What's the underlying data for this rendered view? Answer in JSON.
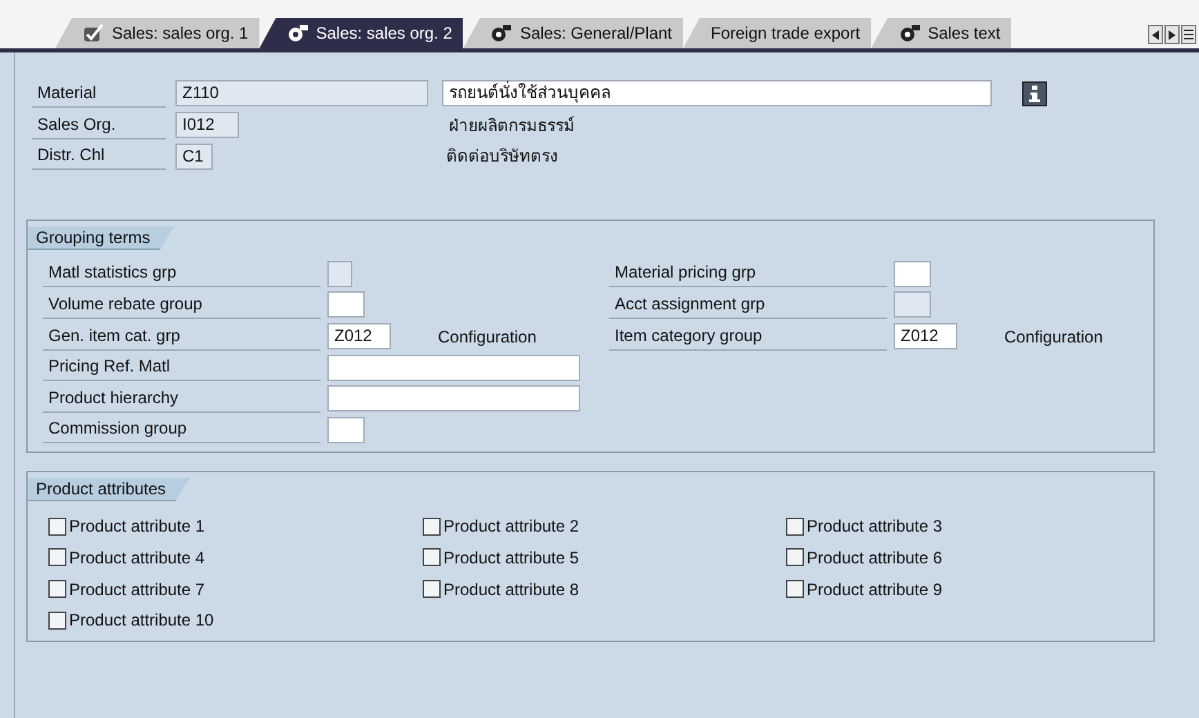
{
  "tabs": [
    {
      "label": "Sales: sales org. 1",
      "kind": "checked",
      "selected": false
    },
    {
      "label": "Sales: sales org. 2",
      "kind": "status",
      "selected": true
    },
    {
      "label": "Sales: General/Plant",
      "kind": "status",
      "selected": false
    },
    {
      "label": "Foreign trade export",
      "kind": "plain",
      "selected": false
    },
    {
      "label": "Sales text",
      "kind": "status",
      "selected": false
    }
  ],
  "header": [
    {
      "label": "Material",
      "value": "Z110",
      "kind": "long",
      "disabled": true,
      "description": {
        "text": "รถยนต์นั่งใช้ส่วนบุคคล",
        "kind": "field"
      }
    },
    {
      "label": "Sales Org.",
      "value": "I012",
      "kind": "code",
      "disabled": true,
      "description": {
        "text": "ฝ่ายผลิตกรมธรรม์",
        "kind": "text"
      }
    },
    {
      "label": "Distr. Chl",
      "value": "C1",
      "kind": "small",
      "disabled": true,
      "description": {
        "text": "ติดต่อบริษัทตรง",
        "kind": "text"
      }
    }
  ],
  "grouping_terms": {
    "title": "Grouping terms",
    "left": [
      {
        "label": "Matl statistics grp",
        "kind": "tiny",
        "disabled": true
      },
      {
        "label": "Volume rebate group",
        "kind": "small",
        "disabled": false
      },
      {
        "label": "Gen. item cat. grp",
        "value": "Z012",
        "kind": "code",
        "disabled": false,
        "note": "Configuration"
      },
      {
        "label": "Pricing Ref. Matl",
        "kind": "long",
        "disabled": false
      },
      {
        "label": "Product hierarchy",
        "kind": "long",
        "disabled": false
      },
      {
        "label": "Commission group",
        "kind": "small",
        "disabled": false
      }
    ],
    "right": [
      {
        "label": "Material pricing grp",
        "kind": "small",
        "disabled": false
      },
      {
        "label": "Acct assignment grp",
        "kind": "small",
        "disabled": true
      },
      {
        "label": "Item category group",
        "value": "Z012",
        "kind": "code",
        "disabled": false,
        "note": "Configuration"
      }
    ]
  },
  "product_attributes": {
    "title": "Product attributes",
    "items": [
      {
        "label": "Product attribute 1",
        "checked": false
      },
      {
        "label": "Product attribute 2",
        "checked": false
      },
      {
        "label": "Product attribute 3",
        "checked": false
      },
      {
        "label": "Product attribute 4",
        "checked": false
      },
      {
        "label": "Product attribute 5",
        "checked": false
      },
      {
        "label": "Product attribute 6",
        "checked": false
      },
      {
        "label": "Product attribute 7",
        "checked": false
      },
      {
        "label": "Product attribute 8",
        "checked": false
      },
      {
        "label": "Product attribute 9",
        "checked": false
      },
      {
        "label": "Product attribute 10",
        "checked": false
      }
    ]
  }
}
